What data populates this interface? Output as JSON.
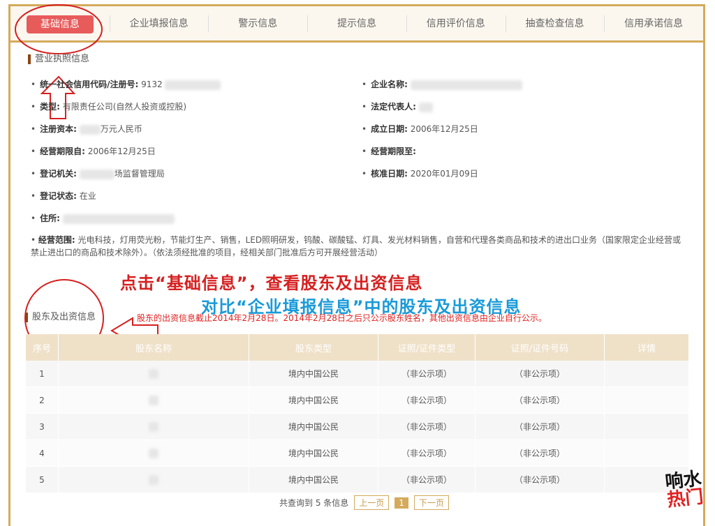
{
  "tabs": [
    "基础信息",
    "企业填报信息",
    "警示信息",
    "提示信息",
    "信用评价信息",
    "抽查检查信息",
    "信用承诺信息"
  ],
  "section1_title": "营业执照信息",
  "fields_left": [
    {
      "label": "统一社会信用代码/注册号:",
      "value": "9132"
    },
    {
      "label": "类型:",
      "value": "有限责任公司(自然人投资或控股)"
    },
    {
      "label": "注册资本:",
      "value": "万元人民币"
    },
    {
      "label": "经营期限自:",
      "value": "2006年12月25日"
    },
    {
      "label": "登记机关:",
      "value": "场监督管理局"
    },
    {
      "label": "登记状态:",
      "value": "在业"
    },
    {
      "label": "住所:",
      "value": ""
    }
  ],
  "fields_right": [
    {
      "label": "企业名称:",
      "value": ""
    },
    {
      "label": "法定代表人:",
      "value": ""
    },
    {
      "label": "成立日期:",
      "value": "2006年12月25日"
    },
    {
      "label": "经营期限至:",
      "value": ""
    },
    {
      "label": "核准日期:",
      "value": "2020年01月09日"
    }
  ],
  "scope_label": "经营范围:",
  "scope_text": "光电科技，灯用荧光粉，节能灯生产、销售，LED照明研发，钨酸、碳酸锰、灯具、发光材料销售，自营和代理各类商品和技术的进出口业务（国家限定企业经营或禁止进出口的商品和技术除外）。（依法须经批准的项目，经相关部门批准后方可开展经营活动）",
  "annotation1": "点击“基础信息”，查看股东及出资信息",
  "annotation2": "对比“企业填报信息”中的股东及出资信息",
  "section2_title": "股东及出资信息",
  "notice": "股东的出资信息截止2014年2月28日。2014年2月28日之后只公示股东姓名，其他出资信息由企业自行公示。",
  "table": {
    "headers": [
      "序号",
      "股东名称",
      "股东类型",
      "证照/证件类型",
      "证照/证件号码",
      "详情"
    ],
    "rows": [
      [
        "1",
        "",
        "境内中国公民",
        "（非公示项）",
        "（非公示项）",
        ""
      ],
      [
        "2",
        "",
        "境内中国公民",
        "（非公示项）",
        "（非公示项）",
        ""
      ],
      [
        "3",
        "",
        "境内中国公民",
        "（非公示项）",
        "（非公示项）",
        ""
      ],
      [
        "4",
        "",
        "境内中国公民",
        "（非公示项）",
        "（非公示项）",
        ""
      ],
      [
        "5",
        "",
        "境内中国公民",
        "（非公示项）",
        "（非公示项）",
        ""
      ]
    ]
  },
  "pager": {
    "summary": "共查询到 5 条信息",
    "prev": "上一页",
    "current": "1",
    "next": "下一页"
  },
  "watermark": {
    "line1": "响水",
    "line2": "热门"
  },
  "colors": {
    "accent": "#d4aa5c",
    "active_tab": "#e85b5b",
    "annotation_red": "#d62020",
    "annotation_blue": "#1a9ad9"
  }
}
